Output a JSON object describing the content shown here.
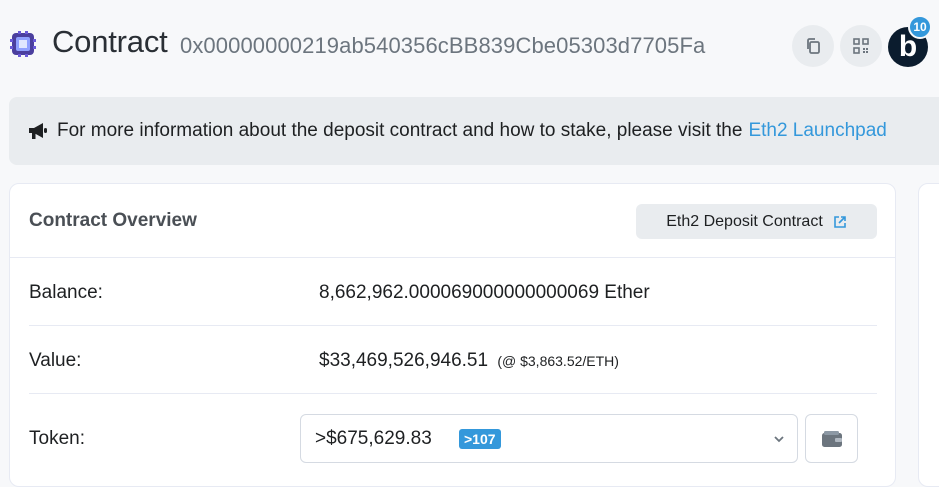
{
  "header": {
    "title": "Contract",
    "address": "0x00000000219ab540356cBB839Cbe05303d7705Fa",
    "avatar_letter": "b",
    "notification_count": "10",
    "icons": [
      "copy-icon",
      "qr-code-icon"
    ]
  },
  "alert": {
    "text": "For more information about the deposit contract and how to stake, please visit the",
    "link": "Eth2 Launchpad"
  },
  "overview": {
    "title": "Contract Overview",
    "tag_button": "Eth2 Deposit Contract",
    "balance_label": "Balance:",
    "balance_value": "8,662,962.000069000000000069 Ether",
    "value_label": "Value:",
    "value_amount": "$33,469,526,946.51",
    "value_rate": "(@ $3,863.52/ETH)",
    "token_label": "Token:",
    "token_value": ">$675,629.83",
    "token_count": ">107"
  },
  "colors": {
    "accent": "#3498db",
    "avatar": "#0b1c2e"
  }
}
